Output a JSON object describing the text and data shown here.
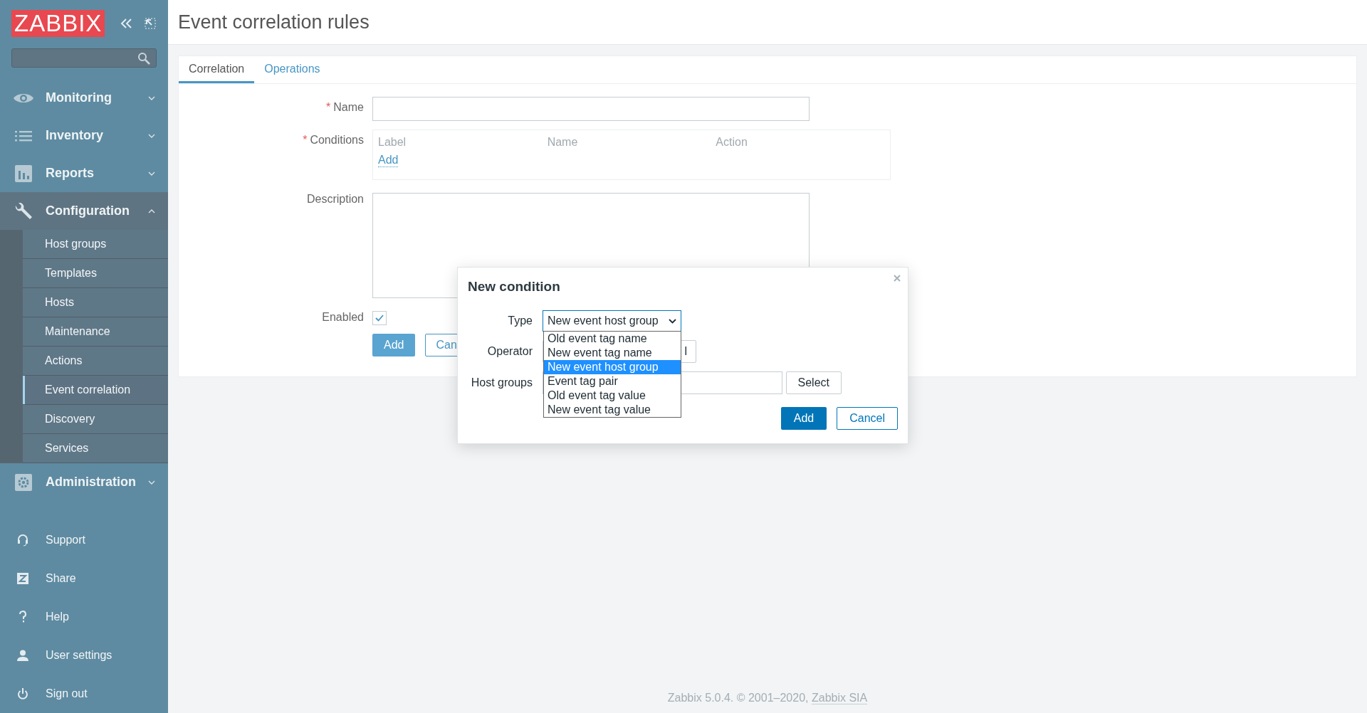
{
  "sidebar": {
    "logo": "ZABBIX",
    "menu": [
      {
        "label": "Monitoring",
        "expanded": false
      },
      {
        "label": "Inventory",
        "expanded": false
      },
      {
        "label": "Reports",
        "expanded": false
      },
      {
        "label": "Configuration",
        "expanded": true,
        "children": [
          {
            "label": "Host groups",
            "selected": false
          },
          {
            "label": "Templates",
            "selected": false
          },
          {
            "label": "Hosts",
            "selected": false
          },
          {
            "label": "Maintenance",
            "selected": false
          },
          {
            "label": "Actions",
            "selected": false
          },
          {
            "label": "Event correlation",
            "selected": true
          },
          {
            "label": "Discovery",
            "selected": false
          },
          {
            "label": "Services",
            "selected": false
          }
        ]
      },
      {
        "label": "Administration",
        "expanded": false
      }
    ],
    "user_menu": [
      "Support",
      "Share",
      "Help",
      "User settings",
      "Sign out"
    ]
  },
  "page_title": "Event correlation rules",
  "tabs": [
    {
      "label": "Correlation",
      "selected": true
    },
    {
      "label": "Operations",
      "selected": false
    }
  ],
  "form": {
    "required_mark": "*",
    "name_label": "Name",
    "conditions_label": "Conditions",
    "conditions_columns": [
      "Label",
      "Name",
      "Action"
    ],
    "conditions_add": "Add",
    "description_label": "Description",
    "enabled_label": "Enabled",
    "enabled": true,
    "buttons": [
      "Add",
      "Can"
    ]
  },
  "dialog": {
    "title": "New condition",
    "type_label": "Type",
    "type_value": "New event host group",
    "type_options": [
      {
        "label": "Old event tag name",
        "selected": false
      },
      {
        "label": "New event tag name",
        "selected": false
      },
      {
        "label": "New event host group",
        "selected": true
      },
      {
        "label": "Event tag pair",
        "selected": false
      },
      {
        "label": "Old event tag value",
        "selected": false
      },
      {
        "label": "New event tag value",
        "selected": false
      }
    ],
    "operator_label": "Operator",
    "operator_value": "l",
    "host_groups_label": "Host groups",
    "select_button": "Select",
    "buttons": [
      "Add",
      "Cancel"
    ]
  },
  "footer": {
    "text": "Zabbix 5.0.4. © 2001–2020,",
    "link": "Zabbix SIA"
  }
}
